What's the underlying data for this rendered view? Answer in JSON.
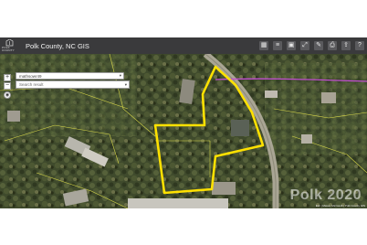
{
  "app": {
    "logo_text": "POLK COUNTY",
    "title": "Polk County, NC  GIS"
  },
  "toolbar": {
    "buttons": [
      {
        "icon": "grid-icon",
        "glyph": "▦"
      },
      {
        "icon": "layers-icon",
        "glyph": "≡"
      },
      {
        "icon": "basemap-icon",
        "glyph": "▣"
      },
      {
        "icon": "measure-icon",
        "glyph": "⤢"
      },
      {
        "icon": "draw-icon",
        "glyph": "✎"
      },
      {
        "icon": "print-icon",
        "glyph": "⎙"
      },
      {
        "icon": "share-icon",
        "glyph": "⇪"
      },
      {
        "icon": "help-icon",
        "glyph": "?"
      }
    ]
  },
  "search": {
    "source_chip": "mathsowr49",
    "placeholder": "Search result"
  },
  "map_controls": {
    "zoom_in": "+",
    "zoom_out": "−",
    "locate": "◉"
  },
  "watermark": "Polk 2020",
  "attribution": "Esri | Maxar, Microsoft | Polk County GIS",
  "colors": {
    "header_bg": "#3a3a3c",
    "parcel_outline": "#ffe100",
    "parcel_lines": "#d9d94a",
    "boundary_line": "#c24fd0"
  }
}
